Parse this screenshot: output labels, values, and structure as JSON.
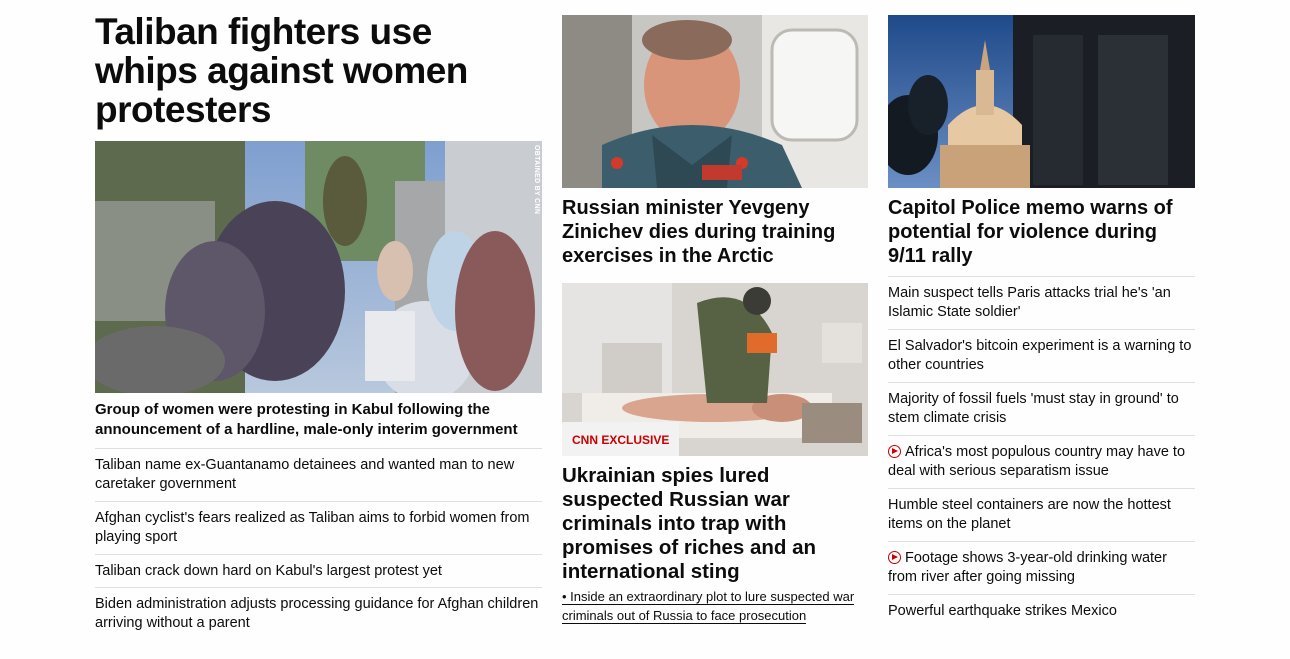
{
  "lead": {
    "headline": "Taliban fighters use whips against women protesters",
    "image_credit": "OBTAINED BY CNN",
    "caption": "Group of women were protesting in Kabul following the announcement of a hardline, male-only interim government",
    "related": [
      "Taliban name ex-Guantanamo detainees and wanted man to new caretaker government",
      "Afghan cyclist's fears realized as Taliban aims to forbid women from playing sport",
      "Taliban crack down hard on Kabul's largest protest yet",
      "Biden administration adjusts processing guidance for Afghan children arriving without a parent"
    ]
  },
  "middle": {
    "story1_headline": "Russian minister Yevgeny Zinichev dies during training exercises in the Arctic",
    "story2_badge": "CNN EXCLUSIVE",
    "story2_headline": "Ukrainian spies lured suspected Russian war criminals into trap with promises of riches and an international sting",
    "story2_sub": "• Inside an extraordinary plot to lure suspected war criminals out of Russia to face prosecution"
  },
  "right": {
    "headline": "Capitol Police memo warns of potential for violence during 9/11 rally",
    "items": [
      {
        "text": "Main suspect tells Paris attacks trial he's 'an Islamic State soldier'",
        "video": false
      },
      {
        "text": "El Salvador's bitcoin experiment is a warning to other countries",
        "video": false
      },
      {
        "text": "Majority of fossil fuels 'must stay in ground' to stem climate crisis",
        "video": false
      },
      {
        "text": "Africa's most populous country may have to deal with serious separatism issue",
        "video": true
      },
      {
        "text": "Humble steel containers are now the hottest items on the planet",
        "video": false
      },
      {
        "text": "Footage shows 3-year-old drinking water from river after going missing",
        "video": true
      },
      {
        "text": "Powerful earthquake strikes Mexico",
        "video": false
      }
    ]
  },
  "colors": {
    "accent": "#cc0000",
    "text": "#0c0c0c",
    "divider": "#dedede"
  }
}
